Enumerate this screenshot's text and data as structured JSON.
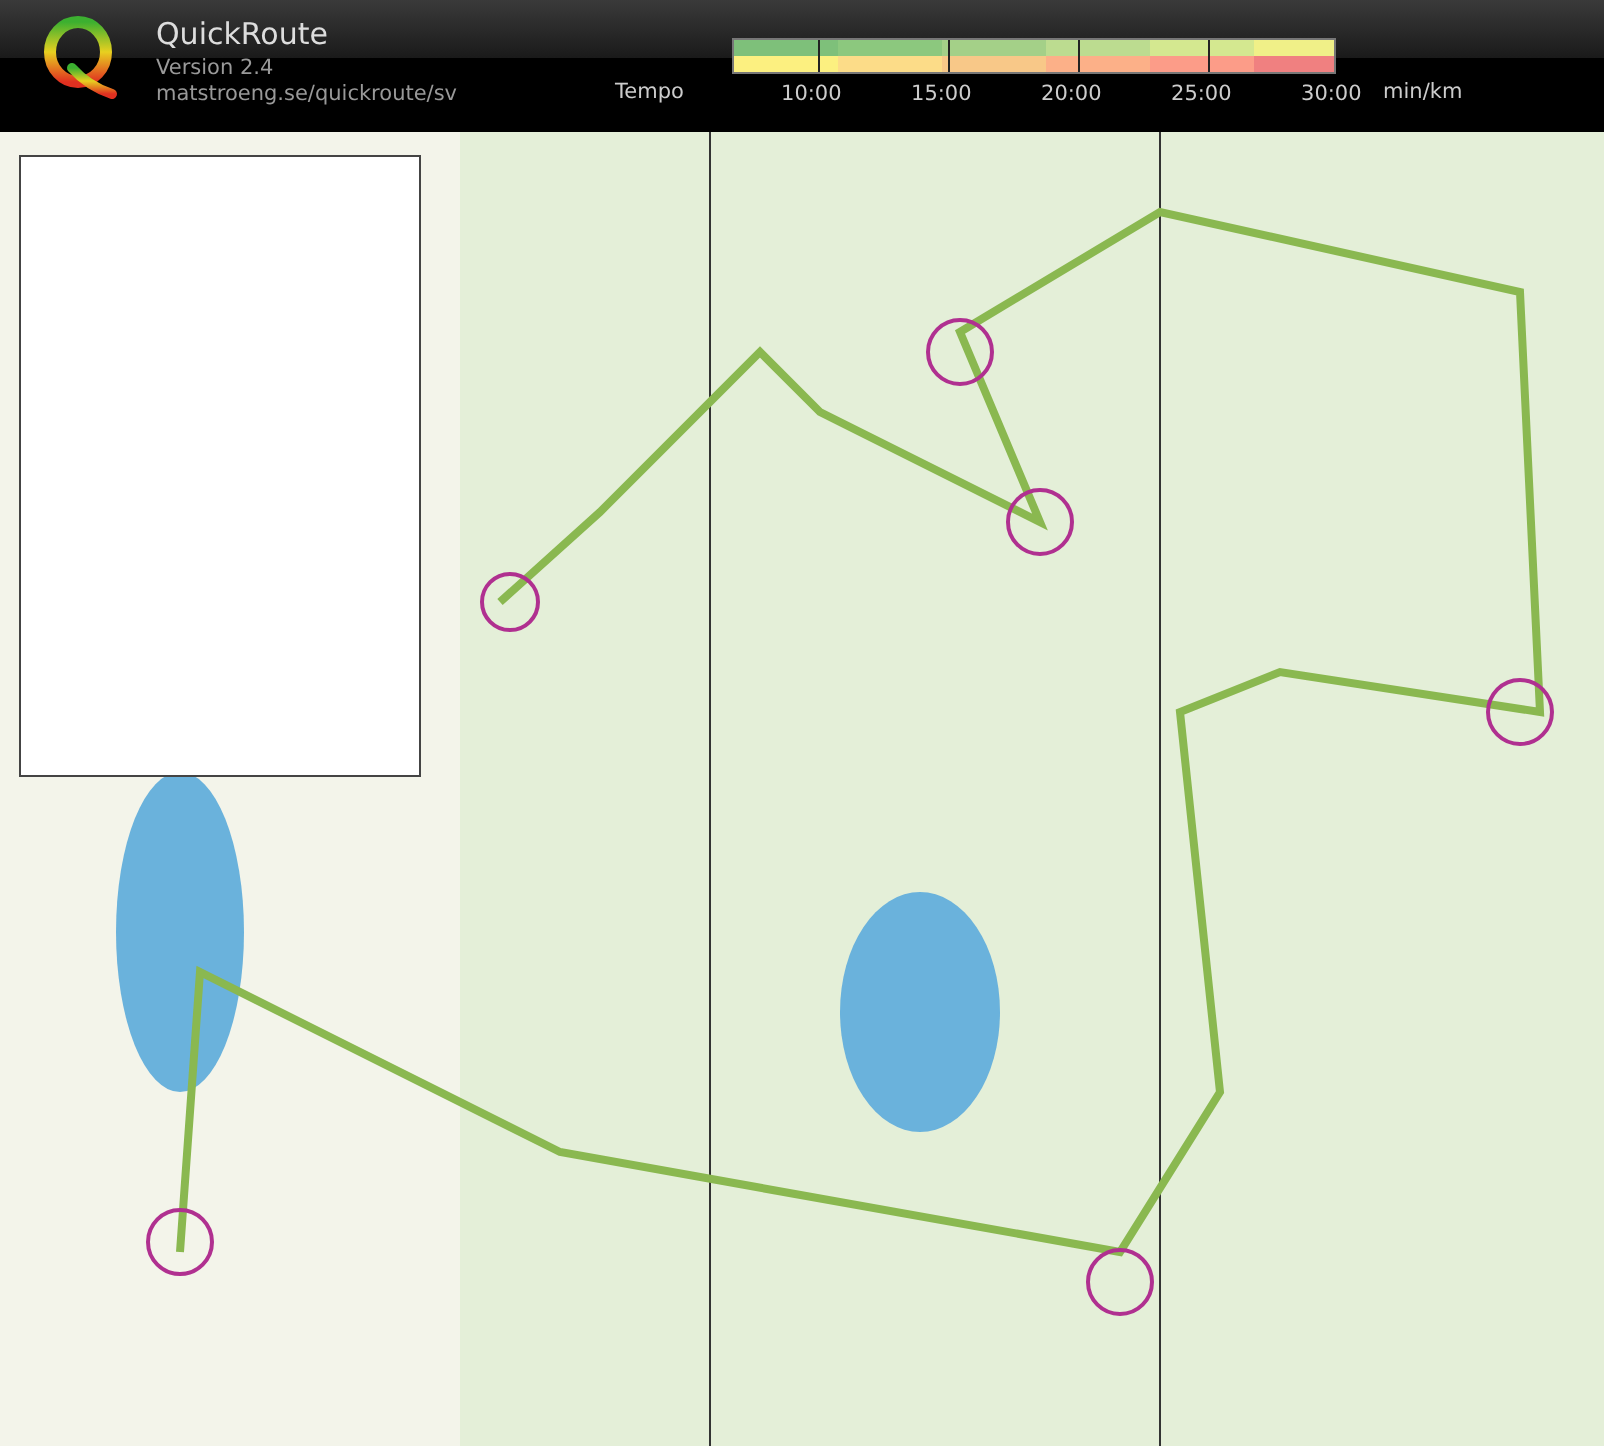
{
  "header": {
    "app_name": "QuickRoute",
    "version": "Version 2.4",
    "url": "matstroeng.se/quickroute/sv"
  },
  "pace_legend": {
    "label": "Tempo",
    "ticks": [
      "10:00",
      "15:00",
      "20:00",
      "25:00",
      "30:00"
    ],
    "unit": "min/km"
  }
}
